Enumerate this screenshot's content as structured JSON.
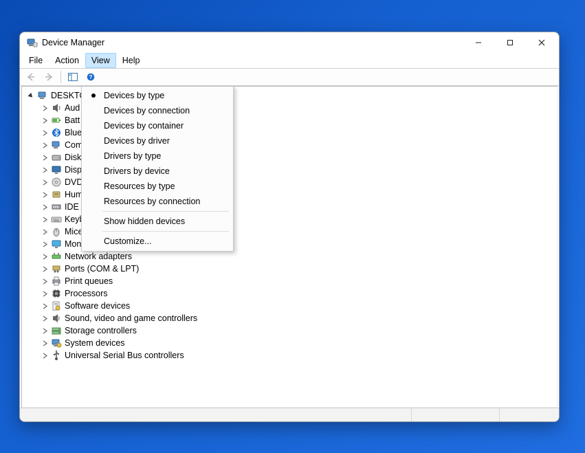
{
  "window": {
    "title": "Device Manager"
  },
  "menubar": {
    "items": [
      {
        "label": "File",
        "active": false
      },
      {
        "label": "Action",
        "active": false
      },
      {
        "label": "View",
        "active": true
      },
      {
        "label": "Help",
        "active": false
      }
    ]
  },
  "view_menu": {
    "group1": [
      {
        "label": "Devices by type",
        "checked": true
      },
      {
        "label": "Devices by connection",
        "checked": false
      },
      {
        "label": "Devices by container",
        "checked": false
      },
      {
        "label": "Devices by driver",
        "checked": false
      },
      {
        "label": "Drivers by type",
        "checked": false
      },
      {
        "label": "Drivers by device",
        "checked": false
      },
      {
        "label": "Resources by type",
        "checked": false
      },
      {
        "label": "Resources by connection",
        "checked": false
      }
    ],
    "group2": [
      {
        "label": "Show hidden devices",
        "checked": false
      }
    ],
    "group3": [
      {
        "label": "Customize...",
        "checked": false
      }
    ]
  },
  "tree": {
    "root": {
      "label": "DESKTOP",
      "label_truncated": "DESKTO",
      "icon": "computer-icon",
      "expanded": true
    },
    "children": [
      {
        "label": "Audio inputs and outputs",
        "label_truncated": "Aud",
        "icon": "audio-icon"
      },
      {
        "label": "Batteries",
        "label_truncated": "Batt",
        "icon": "battery-icon"
      },
      {
        "label": "Bluetooth",
        "label_truncated": "Blue",
        "icon": "bluetooth-icon"
      },
      {
        "label": "Computer",
        "label_truncated": "Com",
        "icon": "computer2-icon"
      },
      {
        "label": "Disk drives",
        "label_truncated": "Disk",
        "icon": "disk-icon"
      },
      {
        "label": "Display adapters",
        "label_truncated": "Disp",
        "icon": "display-icon"
      },
      {
        "label": "DVD/CD-ROM drives",
        "label_truncated": "DVD",
        "icon": "dvd-icon"
      },
      {
        "label": "Human Interface Devices",
        "label_truncated": "Hum",
        "icon": "hid-icon"
      },
      {
        "label": "IDE ATA/ATAPI controllers",
        "label_truncated": "IDE A",
        "icon": "ide-icon"
      },
      {
        "label": "Keyboards",
        "label_truncated": "Keyb",
        "icon": "keyboard-icon"
      },
      {
        "label": "Mice and other pointing devices",
        "label_truncated": "Mice and other pointing devices",
        "icon": "mouse-icon"
      },
      {
        "label": "Monitors",
        "label_truncated": "Monitors",
        "icon": "monitor-icon"
      },
      {
        "label": "Network adapters",
        "label_truncated": "Network adapters",
        "icon": "network-icon"
      },
      {
        "label": "Ports (COM & LPT)",
        "label_truncated": "Ports (COM & LPT)",
        "icon": "ports-icon"
      },
      {
        "label": "Print queues",
        "label_truncated": "Print queues",
        "icon": "printer-icon"
      },
      {
        "label": "Processors",
        "label_truncated": "Processors",
        "icon": "cpu-icon"
      },
      {
        "label": "Software devices",
        "label_truncated": "Software devices",
        "icon": "software-icon"
      },
      {
        "label": "Sound, video and game controllers",
        "label_truncated": "Sound, video and game controllers",
        "icon": "sound-icon"
      },
      {
        "label": "Storage controllers",
        "label_truncated": "Storage controllers",
        "icon": "storage-icon"
      },
      {
        "label": "System devices",
        "label_truncated": "System devices",
        "icon": "system-icon"
      },
      {
        "label": "Universal Serial Bus controllers",
        "label_truncated": "Universal Serial Bus controllers",
        "icon": "usb-icon"
      }
    ]
  }
}
